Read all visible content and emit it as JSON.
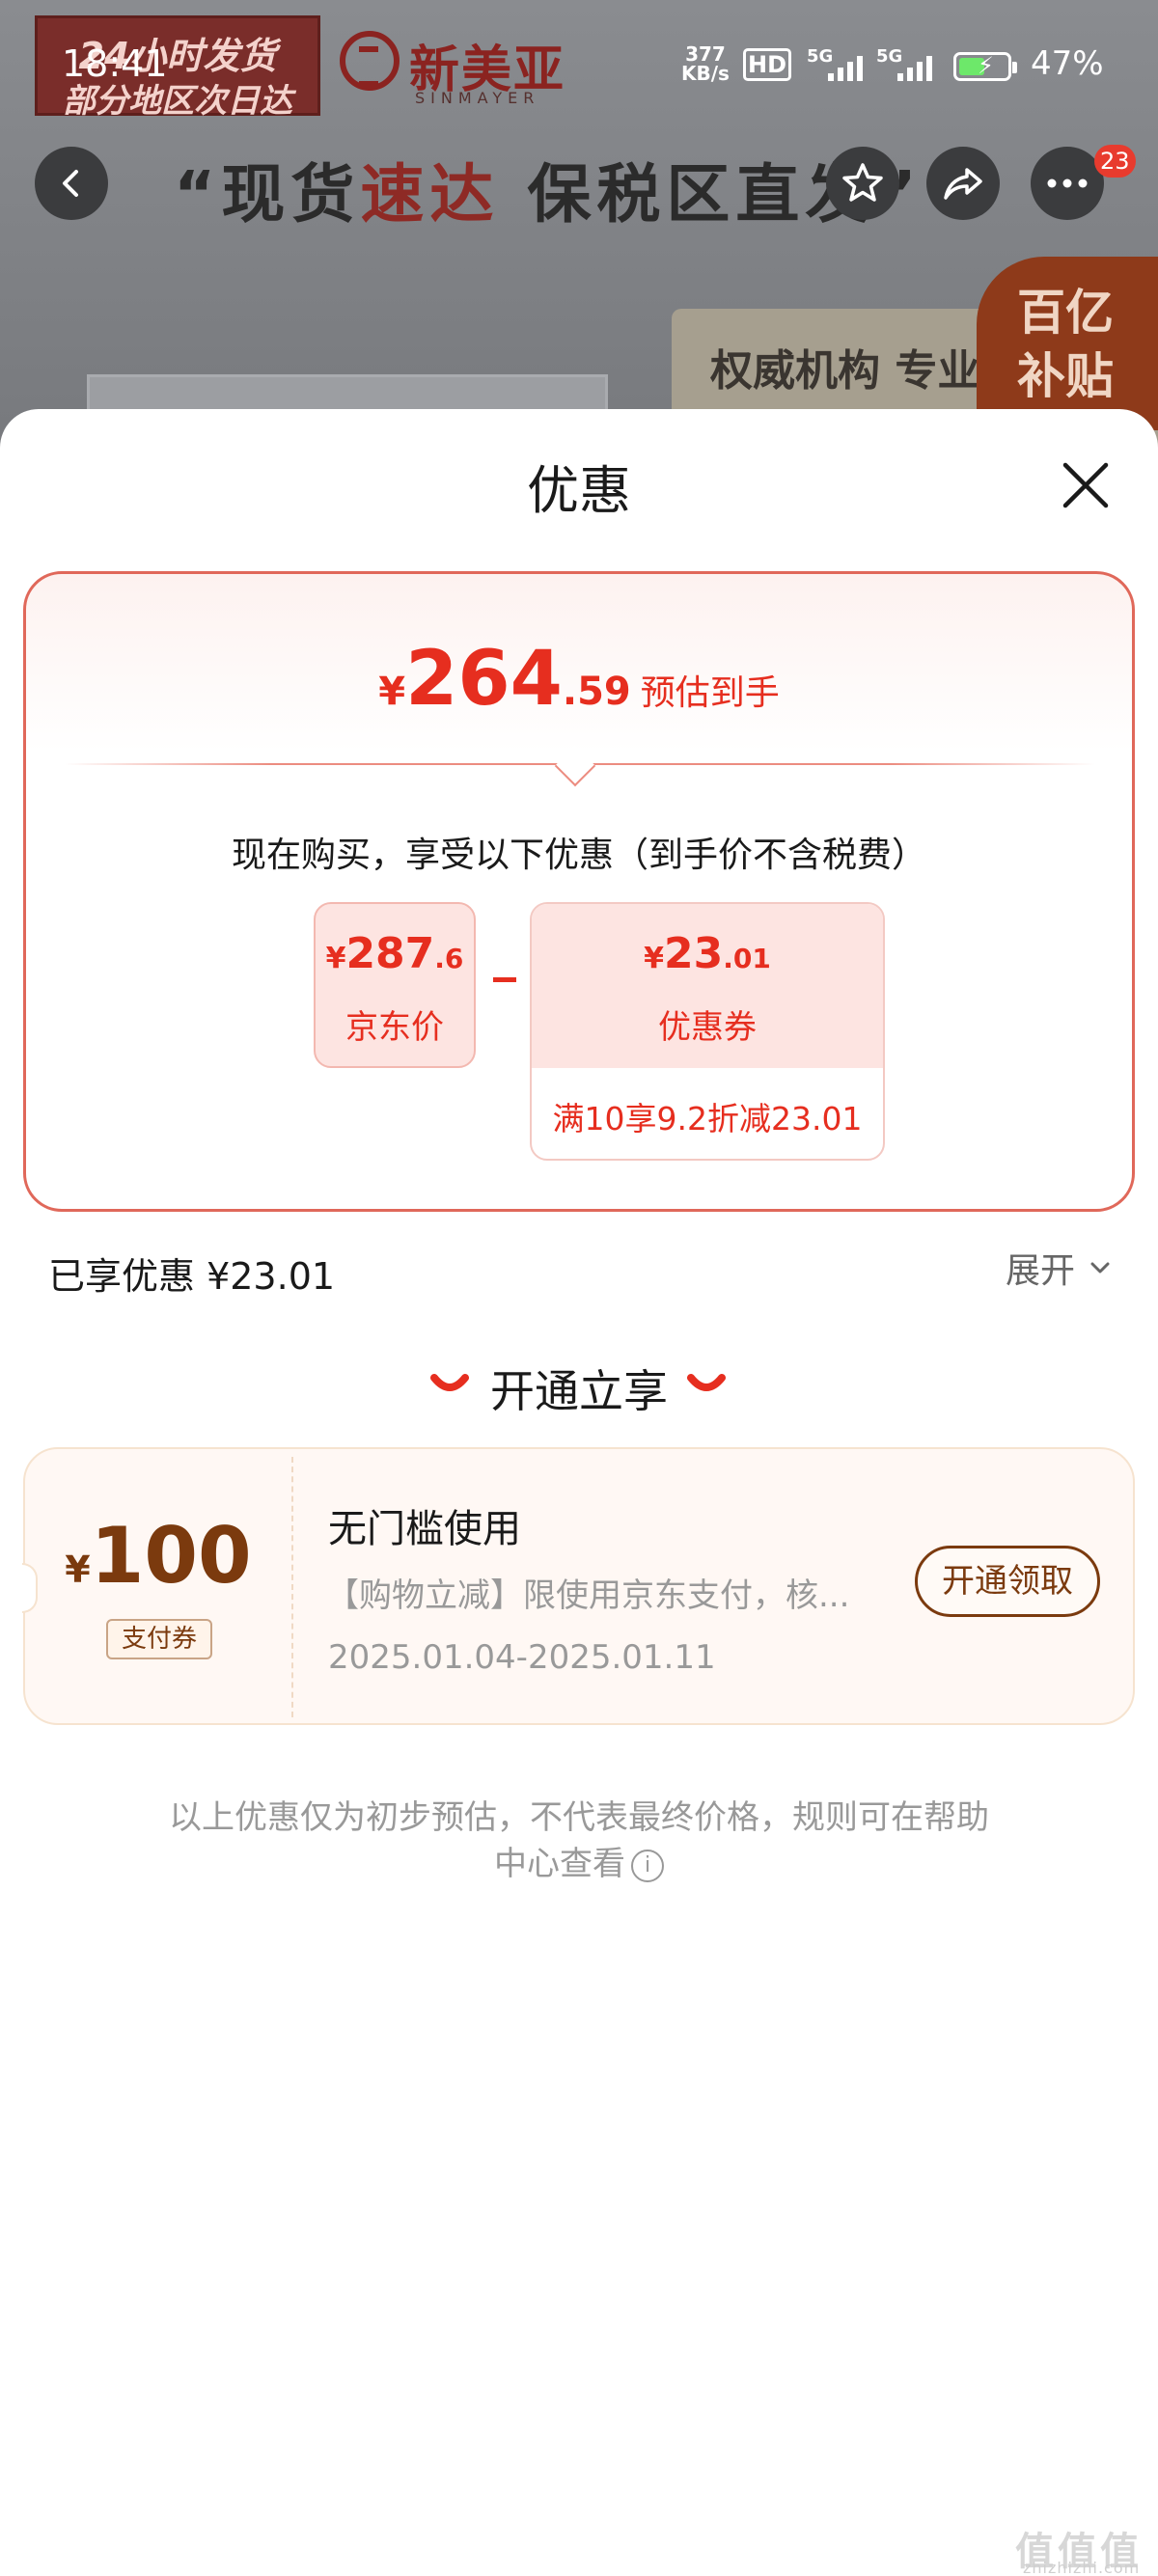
{
  "status_bar": {
    "time": "18:41",
    "net_speed_value": "377",
    "net_speed_unit": "KB/s",
    "hd_label": "HD",
    "signal1": "5G",
    "signal2": "5G",
    "battery": "47%"
  },
  "background_page": {
    "banner_line1": "24小时发货",
    "banner_line2": "部分地区次日达",
    "brand_name": "新美亚",
    "brand_sub": "SINMAYER",
    "slogan_a": "“现货",
    "slogan_b": "速达",
    "slogan_c": " 保税区直发”",
    "card_text": "权威机构 专业",
    "promo_line1": "百亿",
    "promo_line2": "补贴",
    "more_badge": "23"
  },
  "sheet": {
    "title": "优惠",
    "final_price": {
      "currency": "¥",
      "integer": "264",
      "decimal": ".59",
      "label": "预估到手"
    },
    "description": "现在购买，享受以下优惠（到手价不含税费）",
    "jd_price": {
      "currency": "¥",
      "integer": "287",
      "decimal": ".6",
      "label": "京东价"
    },
    "coupon": {
      "currency": "¥",
      "integer": "23",
      "decimal": ".01",
      "label": "优惠券",
      "rule": "满10享9.2折减23.01"
    },
    "enjoyed_discount": "已享优惠 ¥23.01",
    "expand_label": "展开",
    "open_section_title": "开通立享",
    "voucher": {
      "currency": "¥",
      "amount": "100",
      "tag": "支付券",
      "title": "无门槛使用",
      "description": "【购物立减】限使用京东支付，核...",
      "date_range": "2025.01.04-2025.01.11",
      "button_label": "开通领取"
    },
    "footnote_line1": "以上优惠仅为初步预估，不代表最终价格，规则可在帮助",
    "footnote_line2": "中心查看"
  },
  "watermark": {
    "text": "值值值",
    "sub": "zhizhizhi.com"
  },
  "colors": {
    "accent_red": "#e62e1f",
    "voucher_brown": "#7b3a0e",
    "card_border": "#e0685a"
  }
}
